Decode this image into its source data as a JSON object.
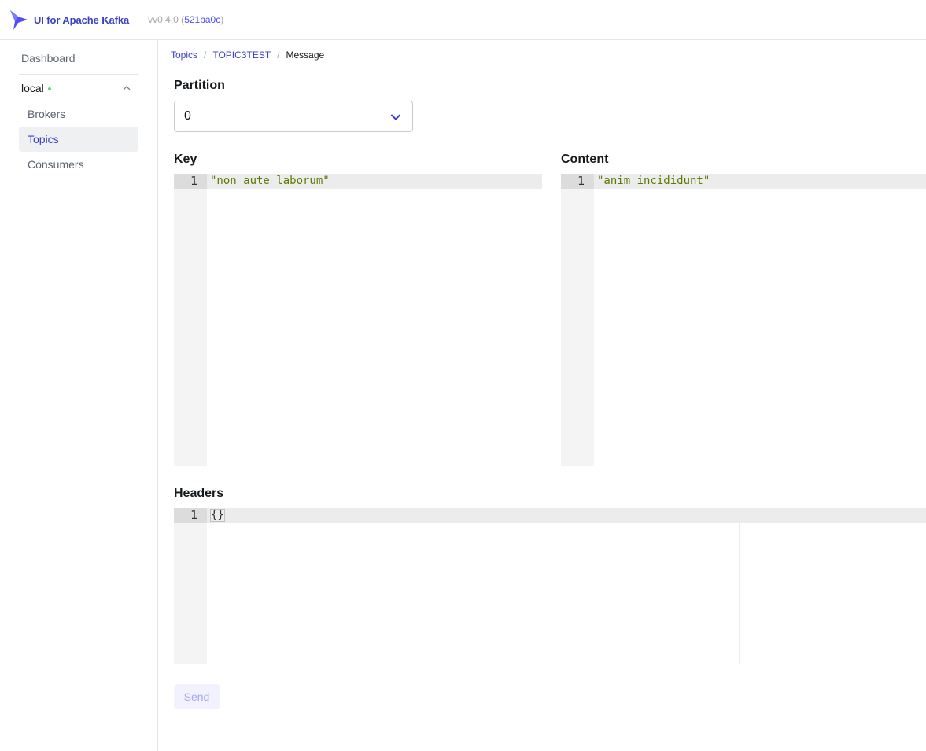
{
  "navbar": {
    "app_title": "UI for Apache Kafka",
    "version_prefix": "vv0.4.0 (",
    "commit": "521ba0c",
    "version_suffix": ")"
  },
  "sidebar": {
    "dashboard": "Dashboard",
    "cluster_name": "local",
    "items": [
      {
        "label": "Brokers",
        "active": false
      },
      {
        "label": "Topics",
        "active": true
      },
      {
        "label": "Consumers",
        "active": false
      }
    ]
  },
  "breadcrumb": {
    "items": [
      "Topics",
      "TOPIC3TEST"
    ],
    "current": "Message",
    "separator": "/"
  },
  "form": {
    "partition_label": "Partition",
    "partition_value": "0",
    "key_label": "Key",
    "content_label": "Content",
    "headers_label": "Headers",
    "key_editor": {
      "line_number": "1",
      "text": "\"non aute laborum\""
    },
    "content_editor": {
      "line_number": "1",
      "text": "\"anim incididunt\""
    },
    "headers_editor": {
      "line_number": "1",
      "text": "{}"
    },
    "send_label": "Send"
  },
  "colors": {
    "accent": "#3b41c5",
    "status_online": "#5cd685",
    "string_literal": "#5b7b00"
  }
}
